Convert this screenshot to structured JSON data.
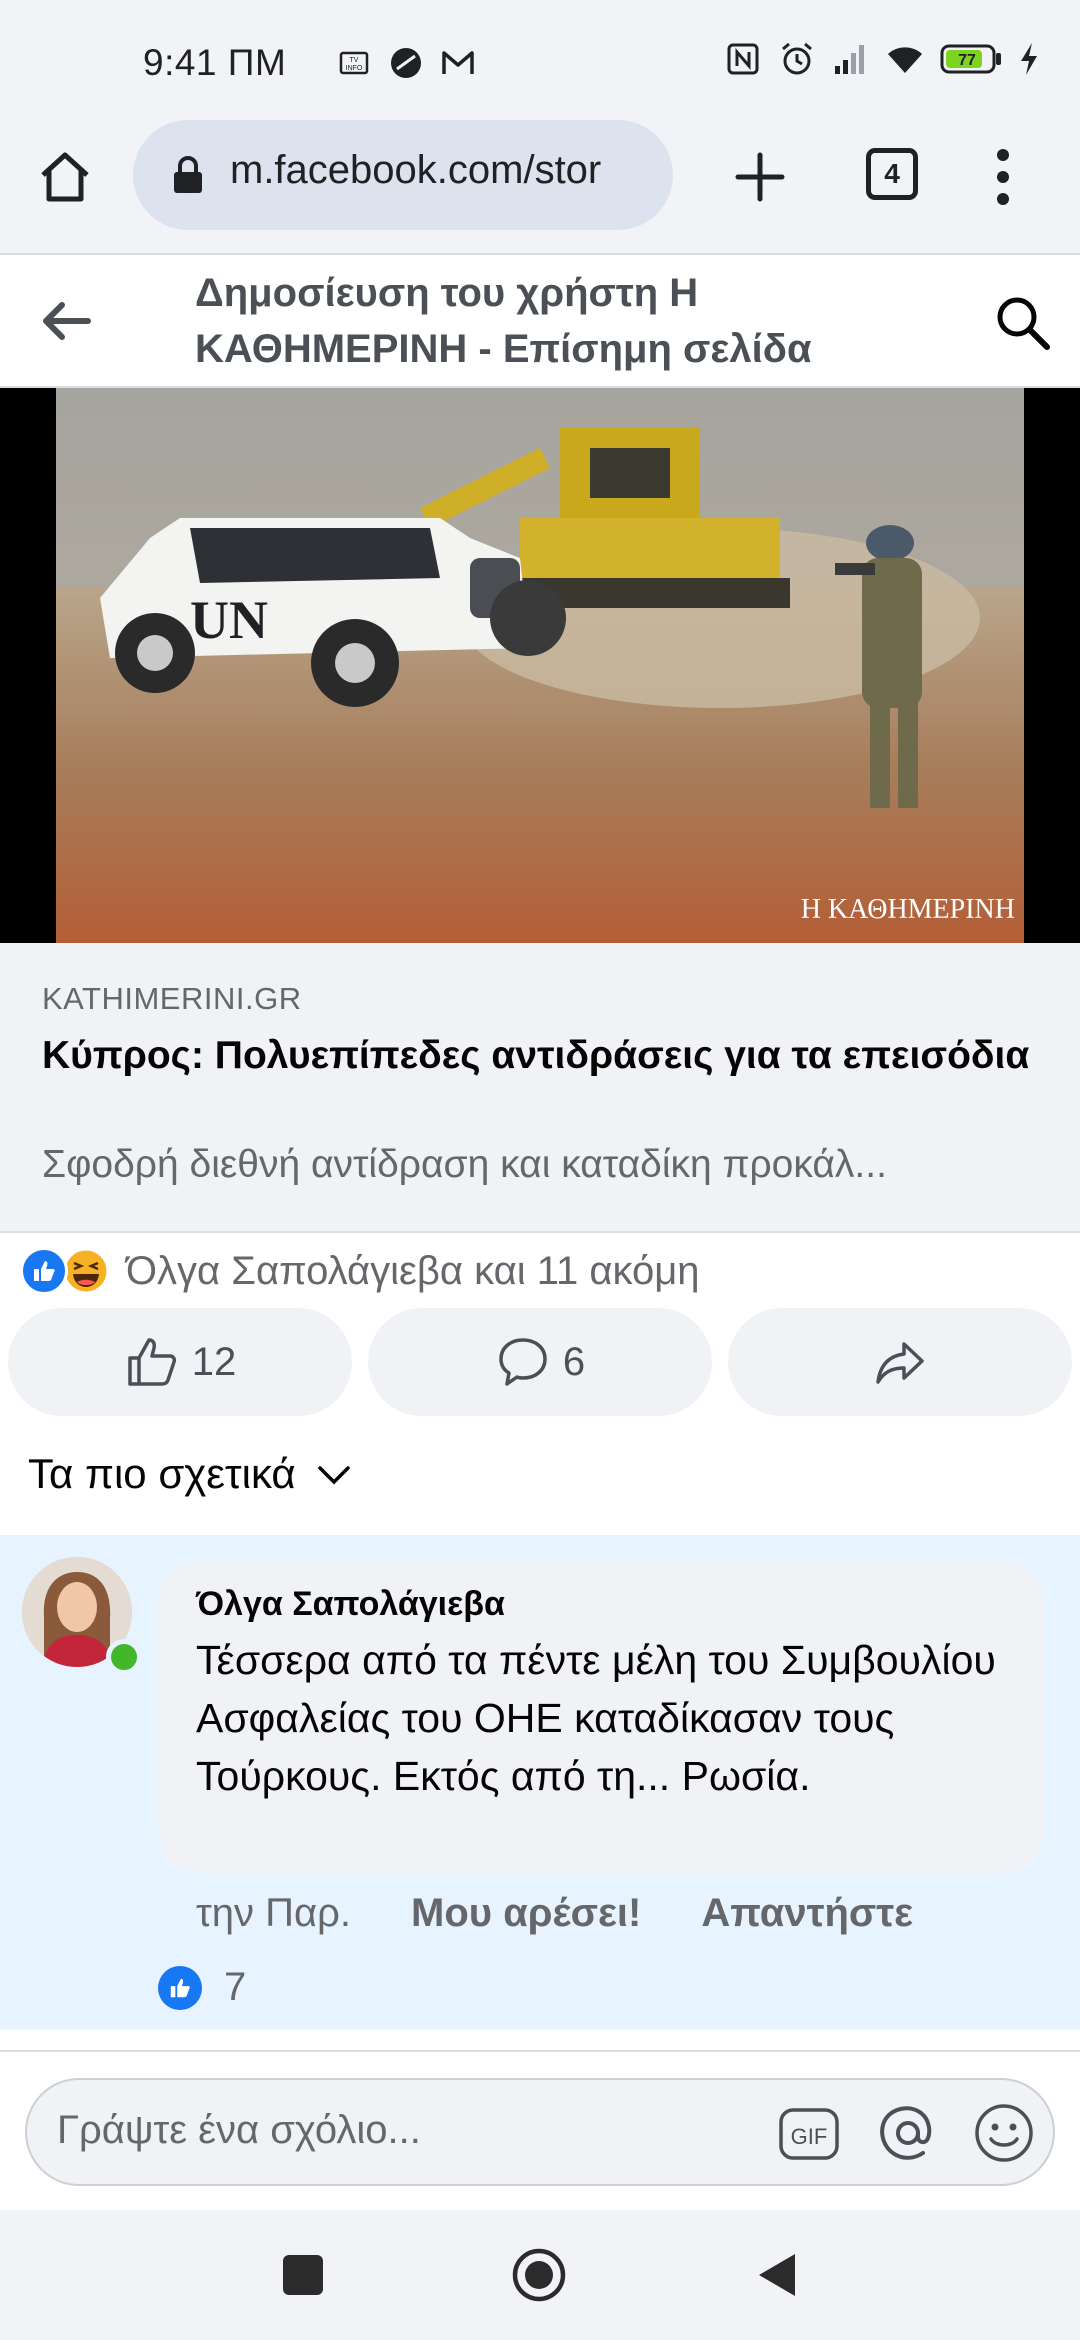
{
  "status_bar": {
    "time": "9:41 ΠΜ",
    "battery": "77",
    "icons": [
      "tv-info-icon",
      "moon-icon",
      "gmail-icon",
      "nfc-icon",
      "alarm-icon",
      "signal-icon",
      "wifi-icon",
      "battery-icon",
      "charging-icon"
    ]
  },
  "browser": {
    "url": "m.facebook.com/stor",
    "tab_count": "4"
  },
  "header": {
    "title": "Δημοσίευση του χρήστη Η ΚΑΘΗΜΕΡΙΝΗ - Επίσημη σελίδα"
  },
  "media": {
    "vehicle_marking": "UN",
    "watermark": "Η ΚΑΘΗΜΕΡΙΝΗ"
  },
  "link_preview": {
    "domain": "KATHIMERINI.GR",
    "title": "Κύπρος: Πολυεπίπεδες αντιδράσεις για τα επεισόδια",
    "description": "Σφοδρή διεθνή αντίδραση και καταδίκη προκάλ..."
  },
  "reactions": {
    "summary": "Όλγα Σαπολάγιεβα και 11 ακόμη",
    "like_count": "12",
    "comment_count": "6"
  },
  "comments_sort": {
    "label": "Τα πιο σχετικά"
  },
  "comment": {
    "author": "Όλγα Σαπολάγιεβα",
    "text": "Τέσσερα από τα πέντε μέλη του Συμβουλίου Ασφαλείας του ΟΗΕ καταδίκασαν τους Τούρκους. Εκτός από τη... Ρωσία.",
    "time": "την Παρ.",
    "like_label": "Μου αρέσει!",
    "reply_label": "Απαντήστε",
    "reaction_count": "7"
  },
  "composer": {
    "placeholder": "Γράψτε ένα σχόλιο..."
  },
  "colors": {
    "facebook_blue": "#1877f2",
    "comment_highlight": "#e7f3ff",
    "online_green": "#42b72a"
  }
}
